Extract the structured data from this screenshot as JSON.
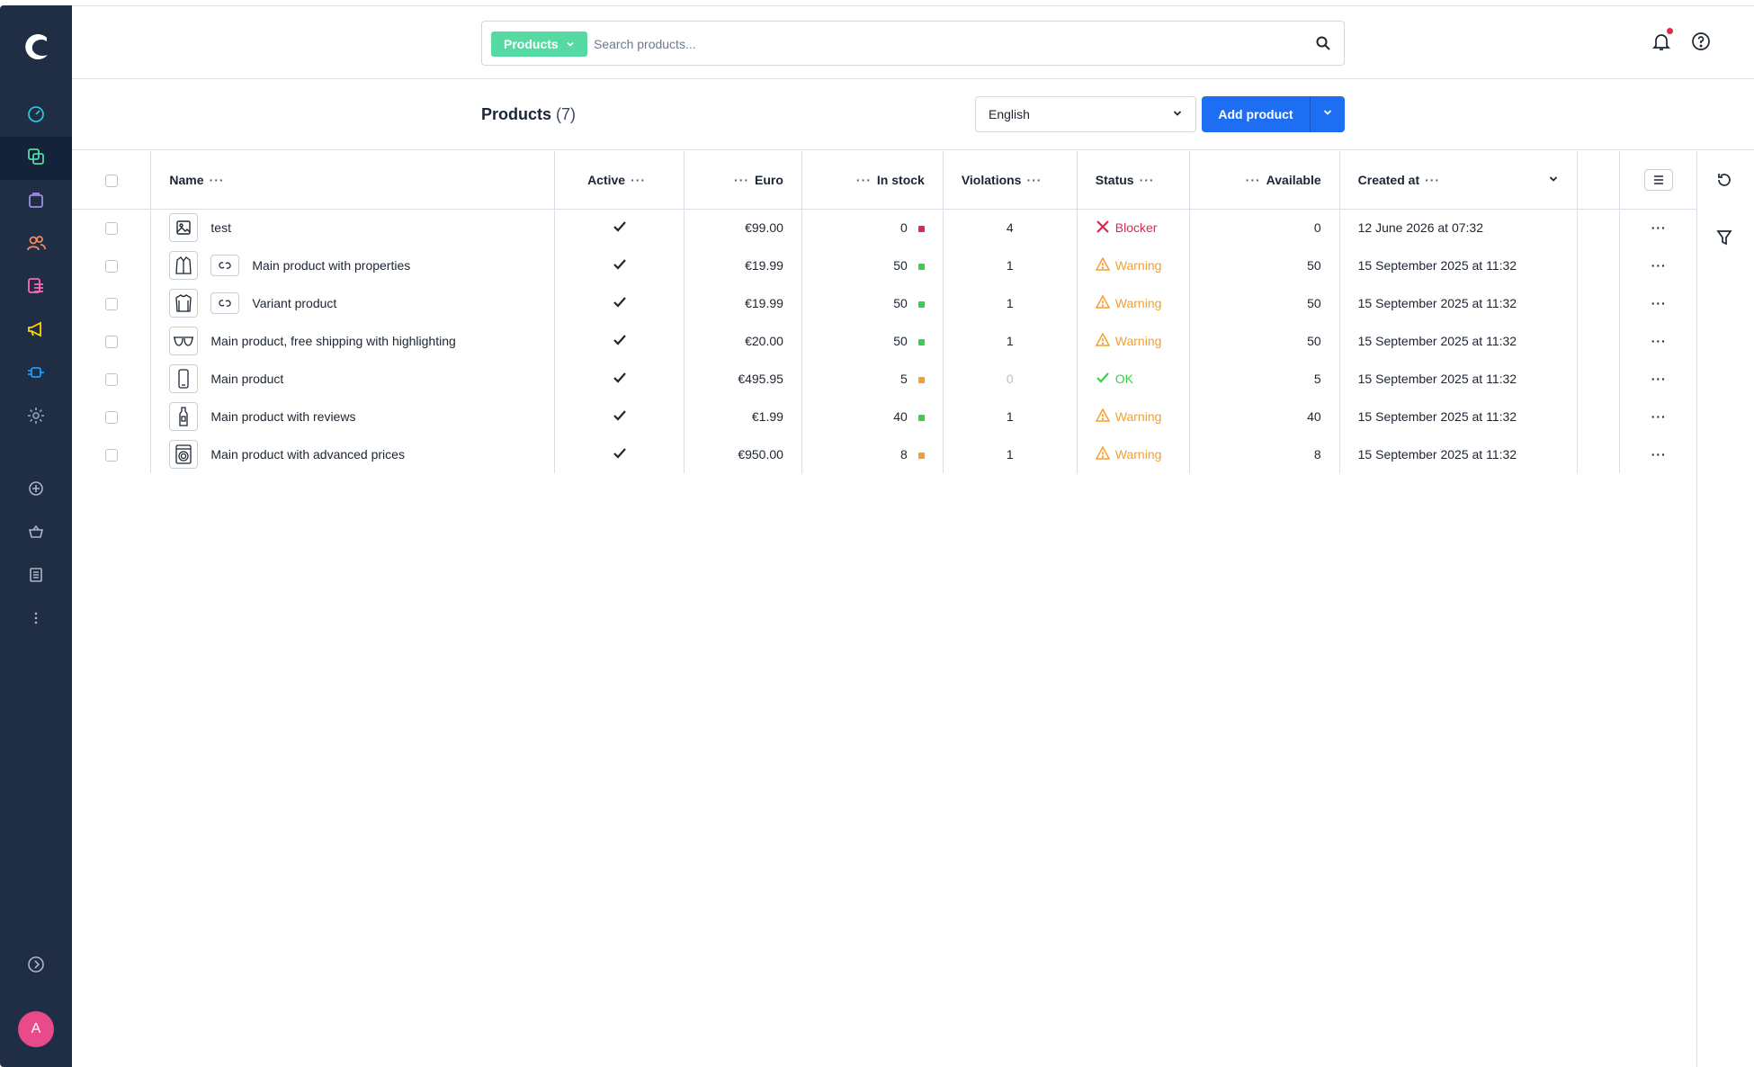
{
  "header": {
    "search_module": "Products",
    "search_placeholder": "Search products..."
  },
  "toolbar": {
    "title": "Products",
    "count": "(7)",
    "language": "English",
    "add_product": "Add product"
  },
  "sidebar": {
    "avatar_letter": "A"
  },
  "colors": {
    "sidebar": "#1f2d45",
    "primary": "#1d6ef2",
    "module": "#57d9a3",
    "blocker": "#de294c",
    "warning": "#f59f31",
    "ok": "#37d046"
  },
  "columns": {
    "name": "Name",
    "active": "Active",
    "euro": "Euro",
    "in_stock": "In stock",
    "violations": "Violations",
    "status": "Status",
    "available": "Available",
    "created_at": "Created at"
  },
  "rows": [
    {
      "name": "test",
      "thumb": "image-placeholder-icon",
      "variant": false,
      "active": "✔",
      "price": "€99.00",
      "stock": "0",
      "stock_level": "red",
      "violations": "4",
      "violations_muted": false,
      "status": "Blocker",
      "status_type": "blocker",
      "available": "0",
      "created": "12 June 2026 at 07:32"
    },
    {
      "name": "Main product with properties",
      "thumb": "jacket-icon",
      "variant": true,
      "active": "✔",
      "price": "€19.99",
      "stock": "50",
      "stock_level": "green",
      "violations": "1",
      "violations_muted": false,
      "status": "Warning",
      "status_type": "warning",
      "available": "50",
      "created": "15 September 2025 at 11:32"
    },
    {
      "name": "Variant product",
      "thumb": "sweater-icon",
      "variant": true,
      "active": "✔",
      "price": "€19.99",
      "stock": "50",
      "stock_level": "green",
      "violations": "1",
      "violations_muted": false,
      "status": "Warning",
      "status_type": "warning",
      "available": "50",
      "created": "15 September 2025 at 11:32"
    },
    {
      "name": "Main product, free shipping with highlighting",
      "thumb": "sunglasses-icon",
      "variant": false,
      "active": "✔",
      "price": "€20.00",
      "stock": "50",
      "stock_level": "green",
      "violations": "1",
      "violations_muted": false,
      "status": "Warning",
      "status_type": "warning",
      "available": "50",
      "created": "15 September 2025 at 11:32"
    },
    {
      "name": "Main product",
      "thumb": "phone-icon",
      "variant": false,
      "active": "✔",
      "price": "€495.95",
      "stock": "5",
      "stock_level": "orange",
      "violations": "0",
      "violations_muted": true,
      "status": "OK",
      "status_type": "ok",
      "available": "5",
      "created": "15 September 2025 at 11:32"
    },
    {
      "name": "Main product with reviews",
      "thumb": "bottle-icon",
      "variant": false,
      "active": "✔",
      "price": "€1.99",
      "stock": "40",
      "stock_level": "green",
      "violations": "1",
      "violations_muted": false,
      "status": "Warning",
      "status_type": "warning",
      "available": "40",
      "created": "15 September 2025 at 11:32"
    },
    {
      "name": "Main product with advanced prices",
      "thumb": "washing-machine-icon",
      "variant": false,
      "active": "✔",
      "price": "€950.00",
      "stock": "8",
      "stock_level": "orange",
      "violations": "1",
      "violations_muted": false,
      "status": "Warning",
      "status_type": "warning",
      "available": "8",
      "created": "15 September 2025 at 11:32"
    }
  ]
}
